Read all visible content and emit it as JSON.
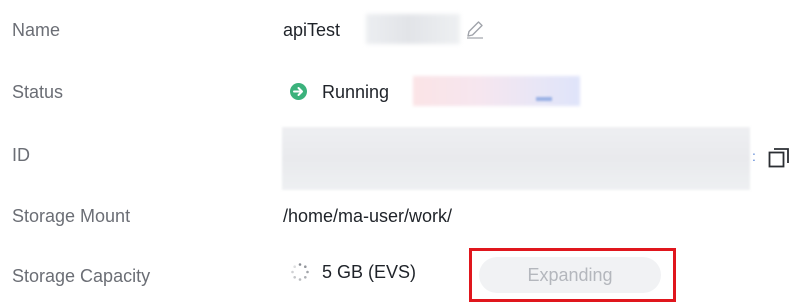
{
  "details": {
    "name": {
      "label": "Name",
      "value": "apiTest"
    },
    "status": {
      "label": "Status",
      "value": "Running",
      "color": "#3bb27c"
    },
    "id": {
      "label": "ID"
    },
    "storage_mount": {
      "label": "Storage Mount",
      "value": "/home/ma-user/work/"
    },
    "storage_capacity": {
      "label": "Storage Capacity",
      "value": "5 GB (EVS)",
      "button_label": "Expanding",
      "highlight_color": "#e0161d"
    }
  },
  "icons": {
    "edit": "edit-icon",
    "status": "status-running-icon",
    "copy": "copy-icon",
    "spinner": "spinner-icon"
  }
}
